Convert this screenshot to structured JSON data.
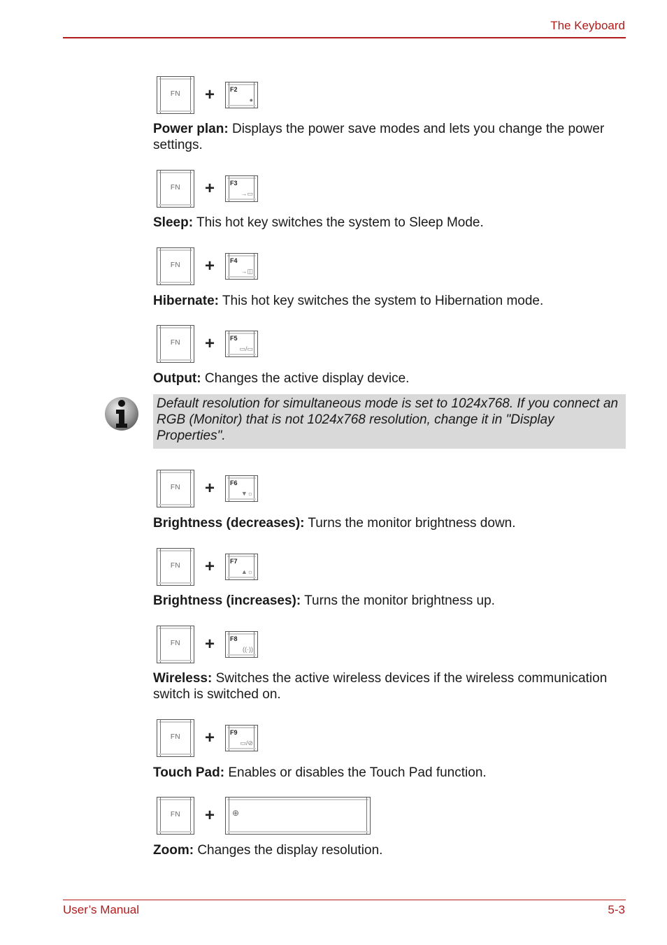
{
  "header": {
    "title": "The Keyboard"
  },
  "footer": {
    "left": "User’s Manual",
    "right": "5-3"
  },
  "colors": {
    "accent": "#b01c1c",
    "note_background": "#d9d9d9"
  },
  "plus_sign": "+",
  "hotkeys": [
    {
      "fn_label": "FN",
      "key_label": "F2",
      "key_icon": "power-plan-icon",
      "key_symbol": "●",
      "term": "Power plan:",
      "description": " Displays the power save modes and lets you change the power settings."
    },
    {
      "fn_label": "FN",
      "key_label": "F3",
      "key_icon": "sleep-icon",
      "key_symbol": "→▭",
      "term": "Sleep:",
      "description": " This hot key switches the system to Sleep Mode."
    },
    {
      "fn_label": "FN",
      "key_label": "F4",
      "key_icon": "hibernate-icon",
      "key_symbol": "→◫",
      "term": "Hibernate:",
      "description": " This hot key switches the system to Hibernation mode."
    },
    {
      "fn_label": "FN",
      "key_label": "F5",
      "key_icon": "output-display-icon",
      "key_symbol": "▭/▭",
      "term": "Output:",
      "description": " Changes the active display device."
    },
    {
      "fn_label": "FN",
      "key_label": "F6",
      "key_icon": "brightness-down-icon",
      "key_symbol": "▼☼",
      "term": "Brightness (decreases):",
      "description": " Turns the monitor brightness down."
    },
    {
      "fn_label": "FN",
      "key_label": "F7",
      "key_icon": "brightness-up-icon",
      "key_symbol": "▲☼",
      "term": "Brightness (increases):",
      "description": " Turns the monitor brightness up."
    },
    {
      "fn_label": "FN",
      "key_label": "F8",
      "key_icon": "wireless-icon",
      "key_symbol": "((·))",
      "term": "Wireless:",
      "description": " Switches the active wireless devices if the wireless communication switch is switched on."
    },
    {
      "fn_label": "FN",
      "key_label": "F9",
      "key_icon": "touchpad-icon",
      "key_symbol": "▭/⊘",
      "term": "Touch Pad:",
      "description": " Enables or disables the Touch Pad function."
    },
    {
      "fn_label": "FN",
      "key_label": "",
      "key_icon": "zoom-icon",
      "key_symbol": "⊕",
      "term": "Zoom:",
      "description": " Changes the display resolution."
    }
  ],
  "note": {
    "icon": "info-icon",
    "text": "Default resolution for simultaneous mode is set to 1024x768. If you connect an RGB (Monitor) that is not 1024x768 resolution, change it in \"Display Properties\"."
  }
}
